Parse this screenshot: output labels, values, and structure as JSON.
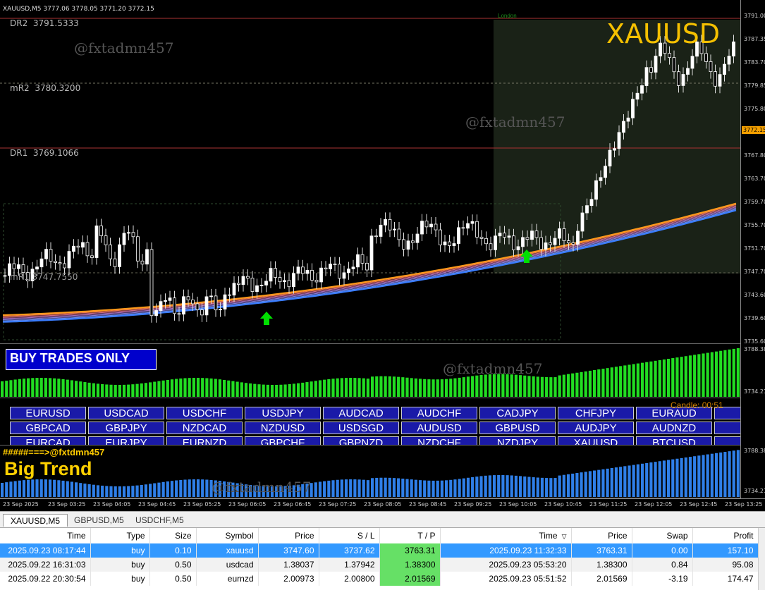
{
  "window": {
    "header": "XAUUSD,M5  3777.06 3778.05 3771.20 3772.15",
    "big_symbol": "XAUUSD",
    "london_label": "London",
    "watermark": "@fxtadmn457"
  },
  "levels": [
    {
      "label": "DR2",
      "value": "3791.5333"
    },
    {
      "label": "mR2",
      "value": "3780.3200"
    },
    {
      "label": "DR1",
      "value": "3769.1066"
    },
    {
      "label": "mR1",
      "value": "3747.7550"
    }
  ],
  "price_axis": [
    "3791.00",
    "3787.35",
    "3783.70",
    "3779.85",
    "3775.80",
    "3772.15",
    "3767.80",
    "3763.70",
    "3759.70",
    "3755.70",
    "3751.70",
    "3747.70",
    "3743.60",
    "3739.60",
    "3735.60"
  ],
  "current_price": "3772.15",
  "indicator1": {
    "banner": "BUY TRADES ONLY",
    "axis_top": "3788.38",
    "axis_bottom": "3734.21"
  },
  "symbols_panel": {
    "candle_label": "Candle:  00:51",
    "rows": [
      [
        "EURUSD",
        "USDCAD",
        "USDCHF",
        "USDJPY",
        "AUDCAD",
        "AUDCHF",
        "CADJPY",
        "CHFJPY",
        "EURAUD",
        "EU"
      ],
      [
        "GBPCAD",
        "GBPJPY",
        "NZDCAD",
        "NZDUSD",
        "USDSGD",
        "AUDUSD",
        "GBPUSD",
        "AUDJPY",
        "AUDNZD",
        "CA"
      ],
      [
        "EURCAD",
        "EURJPY",
        "EURNZD",
        "GBPCHF",
        "GBPNZD",
        "NZDCHF",
        "NZDJPY",
        "XAUUSD",
        "BTCUSD",
        "EU"
      ]
    ]
  },
  "indicator2": {
    "header": "#####===>@fxtdmn457",
    "title": "Big Trend",
    "axis_top": "3788.38",
    "axis_bottom": "3734.21"
  },
  "time_axis": [
    "23 Sep 2025",
    "23 Sep 03:25",
    "23 Sep 04:05",
    "23 Sep 04:45",
    "23 Sep 05:25",
    "23 Sep 06:05",
    "23 Sep 06:45",
    "23 Sep 07:25",
    "23 Sep 08:05",
    "23 Sep 08:45",
    "23 Sep 09:25",
    "23 Sep 10:05",
    "23 Sep 10:45",
    "23 Sep 11:25",
    "23 Sep 12:05",
    "23 Sep 12:45",
    "23 Sep 13:25"
  ],
  "tabs": [
    "XAUUSD,M5",
    "GBPUSD,M5",
    "USDCHF,M5"
  ],
  "trades": {
    "columns": [
      "Time",
      "Type",
      "Size",
      "Symbol",
      "Price",
      "S / L",
      "T / P",
      "Time",
      "Price",
      "Swap",
      "Profit"
    ],
    "sort_marker": "▽",
    "rows": [
      [
        "2025.09.23 08:17:44",
        "buy",
        "0.10",
        "xauusd",
        "3747.60",
        "3737.62",
        "3763.31",
        "2025.09.23 11:32:33",
        "3763.31",
        "0.00",
        "157.10"
      ],
      [
        "2025.09.22 16:31:03",
        "buy",
        "0.50",
        "usdcad",
        "1.38037",
        "1.37942",
        "1.38300",
        "2025.09.23 05:53:20",
        "1.38300",
        "0.84",
        "95.08"
      ],
      [
        "2025.09.22 20:30:54",
        "buy",
        "0.50",
        "eurnzd",
        "2.00973",
        "2.00800",
        "2.01569",
        "2025.09.23 05:51:52",
        "2.01569",
        "-3.19",
        "174.47"
      ]
    ]
  },
  "colors": {
    "buy_arrow": "#00e000",
    "ribbon_top": "#ff9a1a",
    "ribbon_bottom": "#3a7dff",
    "histogram_green": "#22dd22",
    "histogram_blue": "#2f7fe8"
  }
}
